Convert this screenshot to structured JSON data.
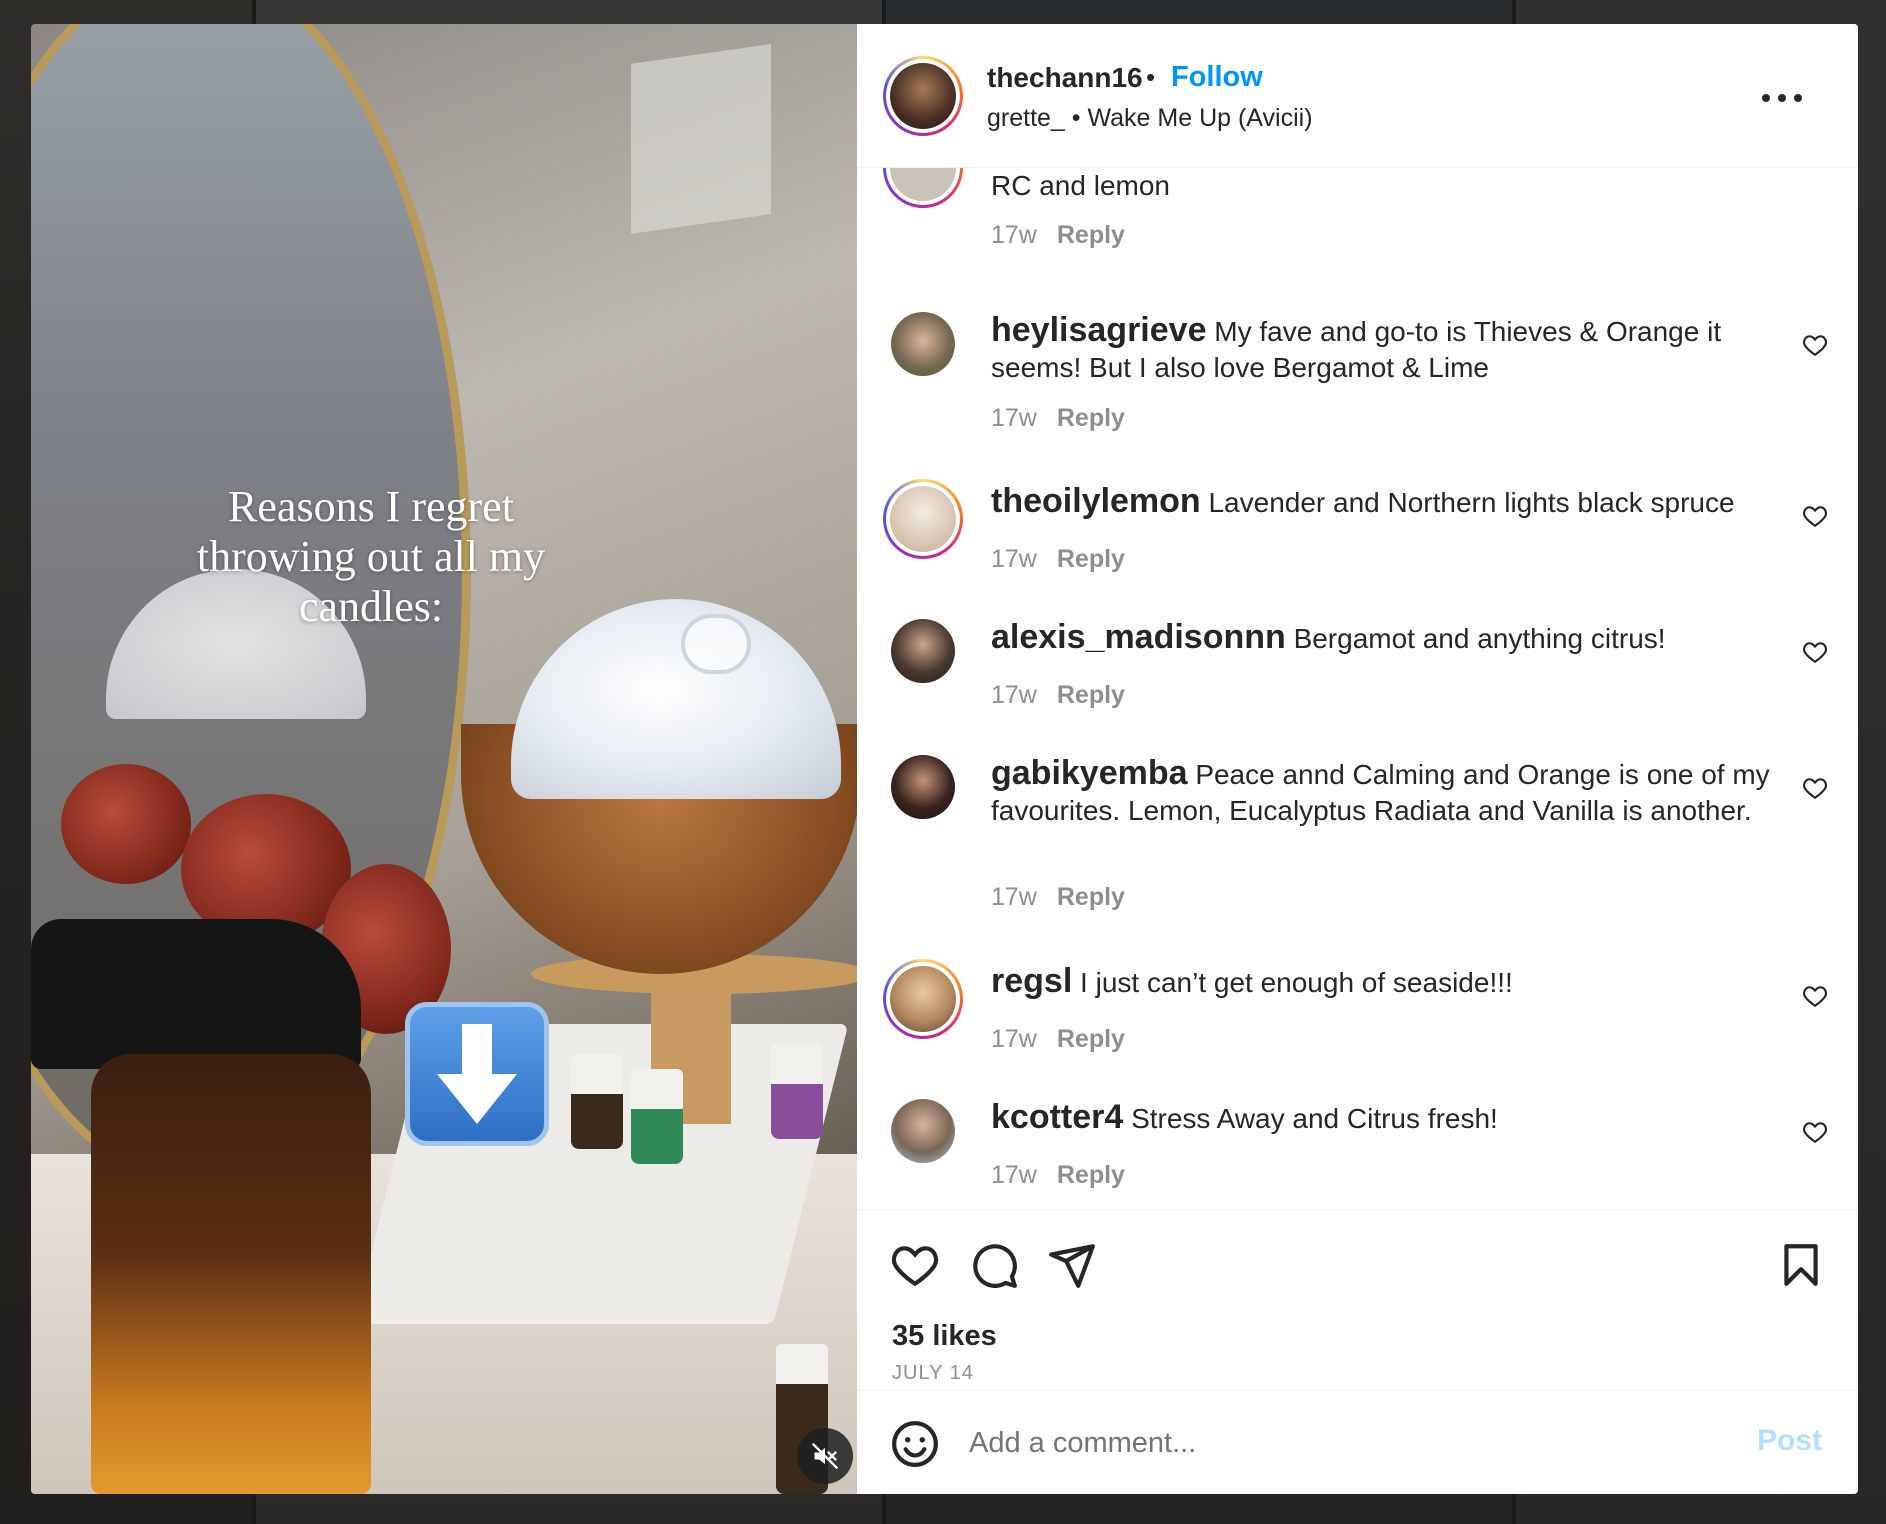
{
  "post": {
    "overlay_text": "Reasons I regret throwing out all my candles:",
    "author": "thechann16",
    "separator": "•",
    "follow_label": "Follow",
    "audio_line": "grette_ • Wake Me Up (Avicii)",
    "likes": "35 likes",
    "date": "JULY 14"
  },
  "comments": [
    {
      "user": "",
      "text": "RC and lemon",
      "age": "17w",
      "reply": "Reply"
    },
    {
      "user": "heylisagrieve",
      "text": "My fave and go-to is Thieves & Orange it seems! But I also love Bergamot & Lime",
      "age": "17w",
      "reply": "Reply"
    },
    {
      "user": "theoilylemon",
      "text": "Lavender and Northern lights black spruce",
      "age": "17w",
      "reply": "Reply"
    },
    {
      "user": "alexis_madisonnn",
      "text": "Bergamot and anything citrus!",
      "age": "17w",
      "reply": "Reply"
    },
    {
      "user": "gabikyemba",
      "text": "Peace annd Calming and Orange is one of my favourites. Lemon, Eucalyptus Radiata and Vanilla is another.",
      "age": "17w",
      "reply": "Reply"
    },
    {
      "user": "regsl",
      "text": "I just can’t get enough of seaside!!!",
      "age": "17w",
      "reply": "Reply"
    },
    {
      "user": "kcotter4",
      "text": "Stress Away and Citrus fresh!",
      "age": "17w",
      "reply": "Reply"
    }
  ],
  "composer": {
    "placeholder": "Add a comment...",
    "post_label": "Post"
  },
  "colors": {
    "link_blue": "#0095f6",
    "post_disabled": "#b2dffc",
    "text": "#262626",
    "muted": "#8e8e8e"
  },
  "icons": [
    "more-options-icon",
    "like-icon",
    "comment-icon",
    "share-icon",
    "save-icon",
    "emoji-icon",
    "mute-icon",
    "comment-like-icon",
    "down-arrow-emoji"
  ]
}
